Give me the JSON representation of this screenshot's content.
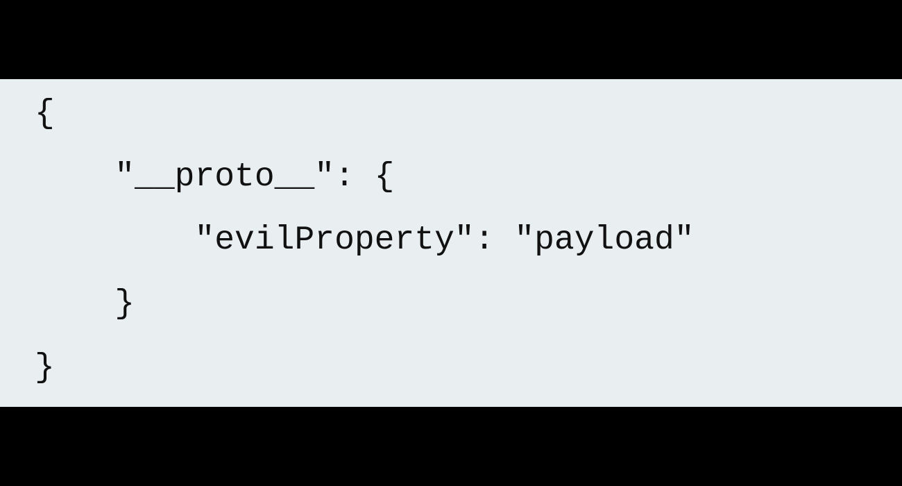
{
  "code_block": {
    "background_color": "#e9eef1",
    "text_color": "#111111",
    "lines": [
      "{",
      "    \"__proto__\": {",
      "        \"evilProperty\": \"payload\"",
      "    }",
      "}"
    ]
  }
}
